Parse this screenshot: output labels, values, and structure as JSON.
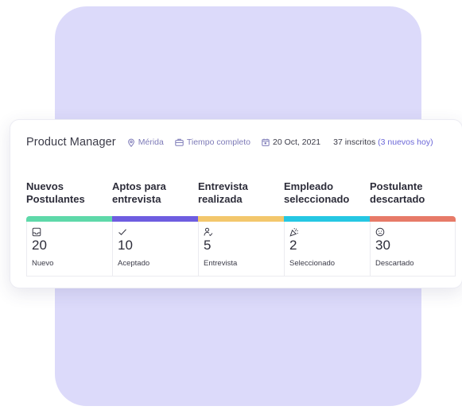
{
  "header": {
    "title": "Product Manager",
    "location": "Mérida",
    "schedule": "Tiempo completo",
    "date": "20 Oct, 2021",
    "applicants": "37 inscritos",
    "new_applicants": "(3 nuevos hoy)",
    "icons": [
      "location-pin-icon",
      "briefcase-icon",
      "calendar-icon"
    ]
  },
  "stages": [
    {
      "title": "Nuevos Postulantes",
      "count": "20",
      "label": "Nuevo",
      "color": "#5ed9a9",
      "icon": "inbox-icon"
    },
    {
      "title": "Aptos para entrevista",
      "count": "10",
      "label": "Aceptado",
      "color": "#6e5de0",
      "icon": "check-icon"
    },
    {
      "title": "Entrevista realizada",
      "count": "5",
      "label": "Entrevista",
      "color": "#f3c76c",
      "icon": "user-check-icon"
    },
    {
      "title": "Empleado seleccionado",
      "count": "2",
      "label": "Seleccionado",
      "color": "#25c7e3",
      "icon": "party-popper-icon"
    },
    {
      "title": "Postulante descartado",
      "count": "30",
      "label": "Descartado",
      "color": "#e77a68",
      "icon": "sad-face-icon"
    }
  ],
  "colors": {
    "background_panel": "#dcdafa",
    "accent": "#6b67d8"
  }
}
